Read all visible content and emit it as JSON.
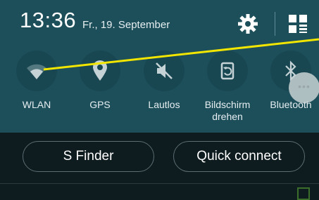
{
  "status": {
    "time": "13:36",
    "date": "Fr., 19. September"
  },
  "header_icons": [
    "gear-icon",
    "grid-edit-icon"
  ],
  "toggles": [
    {
      "label": "WLAN",
      "icon": "wifi-icon"
    },
    {
      "label": "GPS",
      "icon": "location-pin-icon"
    },
    {
      "label": "Lautlos",
      "icon": "mute-icon"
    },
    {
      "label": "Bildschirm drehen",
      "icon": "screen-rotate-icon"
    },
    {
      "label": "Bluetooth",
      "icon": "bluetooth-icon"
    }
  ],
  "more_icon": "more-dots-icon",
  "buttons": {
    "sfinder": "S Finder",
    "quick_connect": "Quick connect"
  },
  "colors": {
    "panel": "#1d4f5b",
    "toggle_circle": "#184752",
    "annotation_line": "#f2e600",
    "bottom": "#0e1b1f"
  }
}
